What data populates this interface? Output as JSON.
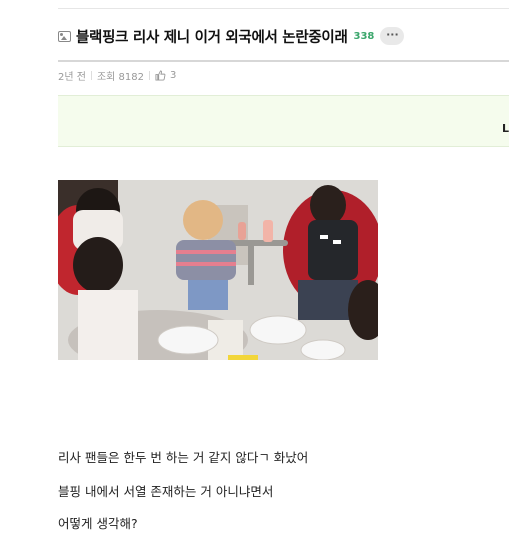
{
  "post": {
    "title": "블랙핑크 리사 제니 이거 외국에서 논란중이래",
    "comment_count": "338",
    "more_label": "···",
    "meta": {
      "time": "2년 전",
      "views": "조회 8182",
      "likes": "3"
    },
    "banner_edge_text": "L",
    "paragraphs": [
      "리사 팬들은 한두 번 하는 거 같지 않다ㄱ 화났어",
      "블핑 내에서 서열 존재하는 거 아니냐면서",
      "어떻게 생각해?"
    ]
  },
  "icons": {
    "title_icon": "image-icon",
    "like_icon": "thumbs-up-icon",
    "more_icon": "more-icon"
  },
  "colors": {
    "comment_count": "#3aa66b",
    "banner_bg": "#f5fced"
  }
}
